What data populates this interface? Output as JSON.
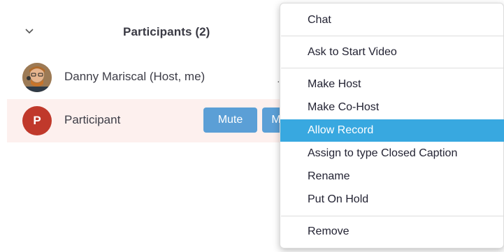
{
  "participants_panel": {
    "title": "Participants (2)",
    "collapse_icon": "chevron-down-icon",
    "participants": [
      {
        "name": "Danny Mariscal (Host, me)",
        "avatar": "photo"
      },
      {
        "name": "Participant",
        "avatar_initial": "P",
        "avatar_color": "#c0392b",
        "highlighted": true
      }
    ],
    "mute_label": "Mute",
    "more_label": "M"
  },
  "context_menu": {
    "items": [
      {
        "label": "Chat"
      },
      {
        "label": "Ask to Start Video"
      },
      {
        "label": "Make Host"
      },
      {
        "label": "Make Co-Host"
      },
      {
        "label": "Allow Record",
        "active": true
      },
      {
        "label": "Assign to type Closed Caption"
      },
      {
        "label": "Rename"
      },
      {
        "label": "Put On Hold"
      },
      {
        "label": "Remove"
      }
    ]
  },
  "colors": {
    "accent": "#38a8e0",
    "button": "#5b9fd6",
    "highlight_row": "#fdf0ee"
  }
}
